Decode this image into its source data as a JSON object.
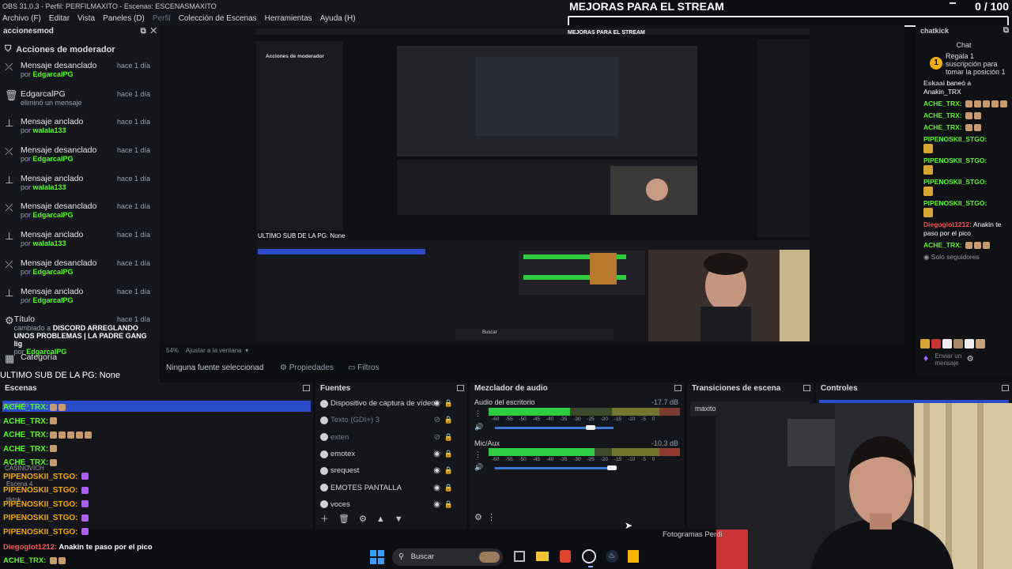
{
  "window": {
    "title": "OBS 31.0.3 - Perfil: PERFILMAXITO - Escenas: ESCENASMAXITO"
  },
  "menu": [
    {
      "label": "Archivo (F)",
      "enabled": true
    },
    {
      "label": "Editar",
      "enabled": true
    },
    {
      "label": "Vista",
      "enabled": true
    },
    {
      "label": "Paneles (D)",
      "enabled": true
    },
    {
      "label": "Perfil",
      "enabled": false
    },
    {
      "label": "Colección de Escenas",
      "enabled": true
    },
    {
      "label": "Herramientas",
      "enabled": true
    },
    {
      "label": "Ayuda (H)",
      "enabled": true
    }
  ],
  "goal": {
    "title": "MEJORAS PARA EL STREAM",
    "count": "0 / 100"
  },
  "mod_dock": {
    "header": "accionesmod",
    "title": "Acciones de moderador",
    "items": [
      {
        "icon": "unpin-icon",
        "action": "Mensaje desanclado",
        "by_prefix": "por",
        "user": "EdgarcalPG",
        "when": "hace 1 día"
      },
      {
        "icon": "trash-icon",
        "action": "EdgarcalPG",
        "by_prefix": "eliminó un mensaje",
        "user": "",
        "when": "hace 1 día"
      },
      {
        "icon": "pin-icon",
        "action": "Mensaje anclado",
        "by_prefix": "por",
        "user": "walala133",
        "when": "hace 1 día"
      },
      {
        "icon": "unpin-icon",
        "action": "Mensaje desanclado",
        "by_prefix": "por",
        "user": "EdgarcalPG",
        "when": "hace 1 día"
      },
      {
        "icon": "pin-icon",
        "action": "Mensaje anclado",
        "by_prefix": "por",
        "user": "walala133",
        "when": "hace 1 día"
      },
      {
        "icon": "unpin-icon",
        "action": "Mensaje desanclado",
        "by_prefix": "por",
        "user": "EdgarcalPG",
        "when": "hace 1 día"
      },
      {
        "icon": "pin-icon",
        "action": "Mensaje anclado",
        "by_prefix": "por",
        "user": "walala133",
        "when": "hace 1 día"
      },
      {
        "icon": "unpin-icon",
        "action": "Mensaje desanclado",
        "by_prefix": "por",
        "user": "EdgarcalPG",
        "when": "hace 1 día"
      },
      {
        "icon": "pin-icon",
        "action": "Mensaje anclado",
        "by_prefix": "por",
        "user": "EdgarcalPG",
        "when": "hace 1 día"
      }
    ],
    "title_change": {
      "action": "Título",
      "prefix": "cambiado a",
      "value": "DISCORD ARREGLANDO UNOS PROBLEMAS | LA PADRE GANG lig",
      "by_prefix": "por",
      "user": "EdgarcalPG",
      "when": "hace 1 día"
    },
    "category_label": "Categoría"
  },
  "preview": {
    "zoom": "54%",
    "fit_label": "Ajustar a la ventana",
    "no_source": "Ninguna fuente seleccionad",
    "properties": "Propiedades",
    "filters": "Filtros",
    "inner_labels": [
      "ULTIMO SUB DE LA PG: None",
      "Acciones de moderador",
      "MEJORAS PARA EL STREAM",
      "Buscar"
    ]
  },
  "overlay_last_sub": "ULTIMO SUB DE LA PG: None",
  "chat": {
    "header": "chatkick",
    "title": "Chat",
    "gift": "Regala 1 suscripción para tomar la posición 1",
    "messages": [
      {
        "user": "Eskaai",
        "text": "baneó a Anakin_TRX",
        "color": "#bbbbbb"
      },
      {
        "user": "ACHE_TRX:",
        "text": "",
        "emotes": 5,
        "color": "#53fc18"
      },
      {
        "user": "ACHE_TRX:",
        "text": "",
        "emotes": 2,
        "color": "#53fc18"
      },
      {
        "user": "ACHE_TRX:",
        "text": "",
        "emotes": 2,
        "color": "#53fc18"
      },
      {
        "user": "PIPENOSKII_STGO:",
        "text": "",
        "emotes": 1,
        "color": "#53fc18"
      },
      {
        "user": "PIPENOSKII_STGO:",
        "text": "",
        "emotes": 1,
        "color": "#53fc18"
      },
      {
        "user": "PIPENOSKII_STGO:",
        "text": "",
        "emotes": 1,
        "color": "#53fc18"
      },
      {
        "user": "PIPENOSKII_STGO:",
        "text": "",
        "emotes": 1,
        "color": "#53fc18"
      },
      {
        "user": "Diegoglot1212:",
        "text": "Anakin te paso por el pico",
        "color": "#ff4d4d"
      },
      {
        "user": "ACHE_TRX:",
        "text": "",
        "emotes": 3,
        "color": "#53fc18"
      }
    ],
    "followers_only": "Solo seguidores",
    "input_placeholder": "Enviar un mensaje"
  },
  "scenes": {
    "title": "Escenas",
    "ghost_items": [
      "escritorio",
      "CASINOVICH",
      "Escena 4",
      "tiktok"
    ],
    "overlay_lines": [
      {
        "user": "ACHE_TRX:",
        "color": "g",
        "emotes": 2
      },
      {
        "user": "ACHE_TRX:",
        "color": "g",
        "emotes": 1
      },
      {
        "user": "ACHE_TRX:",
        "color": "g",
        "emotes": 5
      },
      {
        "user": "ACHE_TRX:",
        "color": "g",
        "emotes": 1
      },
      {
        "user": "ACHE_TRX:",
        "color": "g",
        "emotes": 1
      },
      {
        "user": "PIPENOSKII_STGO:",
        "color": "o",
        "emotes": 1
      },
      {
        "user": "PIPENOSKII_STGO:",
        "color": "o",
        "emotes": 1
      },
      {
        "user": "PIPENOSKII_STGO:",
        "color": "o",
        "emotes": 1
      },
      {
        "user": "PIPENOSKII_STGO:",
        "color": "o",
        "emotes": 1
      },
      {
        "user": "PIPENOSKII_STGO:",
        "color": "o",
        "emotes": 1
      }
    ]
  },
  "sources": {
    "title": "Fuentes",
    "items": [
      {
        "name": "Dispositivo de captura de vídeo",
        "visible": true
      },
      {
        "name": "Texto (GDI+) 3",
        "visible": false
      },
      {
        "name": "exten",
        "visible": false
      },
      {
        "name": "emotex",
        "visible": true
      },
      {
        "name": "srequest",
        "visible": true
      },
      {
        "name": "EMOTES PANTALLA",
        "visible": true
      },
      {
        "name": "voces",
        "visible": true
      }
    ]
  },
  "mixer": {
    "title": "Mezclador de audio",
    "channels": [
      {
        "name": "Audio del escritorio",
        "db": "-17.7 dB",
        "level": 0.66,
        "volume": 0.82
      },
      {
        "name": "Mic/Aux",
        "db": "-10.3 dB",
        "level": 0.86,
        "volume": 1.0
      }
    ],
    "ticks": "-60 -55 -50 -45 -40 -35 -30 -25 -20 -15 -10 -5 0"
  },
  "transitions": {
    "title": "Transiciones de escena",
    "current": "maxito"
  },
  "controls": {
    "title": "Controles"
  },
  "status": {
    "fps_label": "Fotogramas Perdi"
  },
  "bottom_chat": [
    {
      "user": "Diegoglot1212:",
      "text": "Anakin te paso por el pico",
      "color": "r"
    },
    {
      "user": "ACHE_TRX:",
      "text": "",
      "color": "g"
    }
  ],
  "taskbar": {
    "search": "Buscar"
  }
}
